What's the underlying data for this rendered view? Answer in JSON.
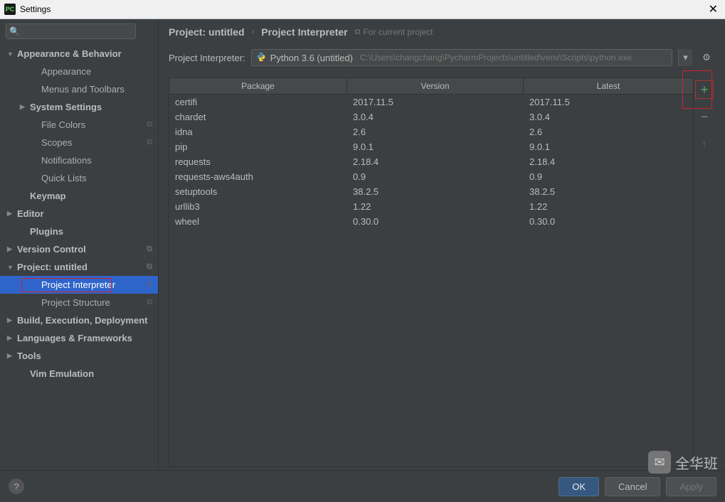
{
  "window": {
    "title": "Settings"
  },
  "search": {
    "placeholder": ""
  },
  "sidebar": [
    {
      "label": "Appearance & Behavior",
      "indent": 0,
      "arrow": "down",
      "bold": true
    },
    {
      "label": "Appearance",
      "indent": 2
    },
    {
      "label": "Menus and Toolbars",
      "indent": 2
    },
    {
      "label": "System Settings",
      "indent": 1,
      "arrow": "right",
      "bold": true
    },
    {
      "label": "File Colors",
      "indent": 2,
      "ricon": true
    },
    {
      "label": "Scopes",
      "indent": 2,
      "ricon": true
    },
    {
      "label": "Notifications",
      "indent": 2
    },
    {
      "label": "Quick Lists",
      "indent": 2
    },
    {
      "label": "Keymap",
      "indent": 1,
      "bold": true
    },
    {
      "label": "Editor",
      "indent": 0,
      "arrow": "right",
      "bold": true
    },
    {
      "label": "Plugins",
      "indent": 1,
      "bold": true
    },
    {
      "label": "Version Control",
      "indent": 0,
      "arrow": "right",
      "bold": true,
      "ricon": true
    },
    {
      "label": "Project: untitled",
      "indent": 0,
      "arrow": "down",
      "bold": true,
      "ricon": true
    },
    {
      "label": "Project Interpreter",
      "indent": 2,
      "ricon": true,
      "selected": true
    },
    {
      "label": "Project Structure",
      "indent": 2,
      "ricon": true
    },
    {
      "label": "Build, Execution, Deployment",
      "indent": 0,
      "arrow": "right",
      "bold": true
    },
    {
      "label": "Languages & Frameworks",
      "indent": 0,
      "arrow": "right",
      "bold": true
    },
    {
      "label": "Tools",
      "indent": 0,
      "arrow": "right",
      "bold": true
    },
    {
      "label": "Vim Emulation",
      "indent": 1,
      "bold": true
    }
  ],
  "breadcrumb": {
    "item1": "Project: untitled",
    "item2": "Project Interpreter",
    "hint": "For current project"
  },
  "interpreter": {
    "label": "Project Interpreter:",
    "name": "Python 3.6 (untitled)",
    "path": "C:\\Users\\changchang\\PycharmProjects\\untitled\\venv\\Scripts\\python.exe"
  },
  "table": {
    "headers": {
      "pkg": "Package",
      "ver": "Version",
      "lat": "Latest"
    },
    "rows": [
      {
        "pkg": "certifi",
        "ver": "2017.11.5",
        "lat": "2017.11.5"
      },
      {
        "pkg": "chardet",
        "ver": "3.0.4",
        "lat": "3.0.4"
      },
      {
        "pkg": "idna",
        "ver": "2.6",
        "lat": "2.6"
      },
      {
        "pkg": "pip",
        "ver": "9.0.1",
        "lat": "9.0.1"
      },
      {
        "pkg": "requests",
        "ver": "2.18.4",
        "lat": "2.18.4"
      },
      {
        "pkg": "requests-aws4auth",
        "ver": "0.9",
        "lat": "0.9"
      },
      {
        "pkg": "setuptools",
        "ver": "38.2.5",
        "lat": "38.2.5"
      },
      {
        "pkg": "urllib3",
        "ver": "1.22",
        "lat": "1.22"
      },
      {
        "pkg": "wheel",
        "ver": "0.30.0",
        "lat": "0.30.0"
      }
    ]
  },
  "buttons": {
    "ok": "OK",
    "cancel": "Cancel",
    "apply": "Apply"
  },
  "watermark": "全华班"
}
